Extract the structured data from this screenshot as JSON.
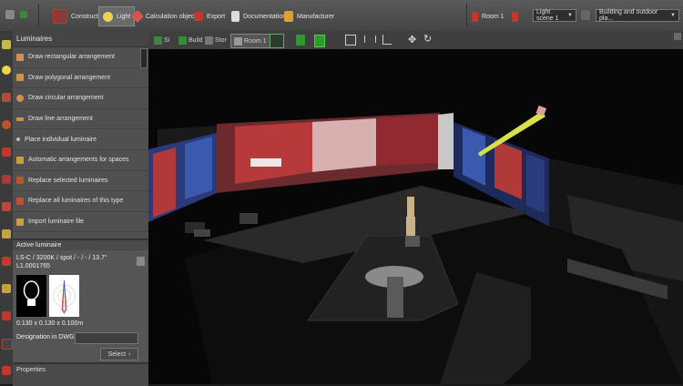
{
  "toolbar": {
    "tabs": [
      {
        "label": "Construction",
        "icon": "construction-icon",
        "color": "#c0392b"
      },
      {
        "label": "Light",
        "icon": "light-bulb-icon",
        "color": "#e8d44d"
      },
      {
        "label": "Calculation objects",
        "icon": "calculation-objects-icon",
        "color": "#d9534f"
      },
      {
        "label": "Export",
        "icon": "export-icon",
        "color": "#c0392b"
      },
      {
        "label": "Documentation",
        "icon": "documentation-icon",
        "color": "#dddddd"
      },
      {
        "label": "Manufacturer",
        "icon": "manufacturer-icon",
        "color": "#e0a030"
      }
    ],
    "room": "Room 1",
    "light_scene": "Light scene 1",
    "view_mode": "Building and outdoor pla..."
  },
  "panel": {
    "title": "Luminaires",
    "items": [
      {
        "label": "Draw rectangular arrangement",
        "icon": "rectangular-arrangement-icon"
      },
      {
        "label": "Draw polygonal arrangement",
        "icon": "polygonal-arrangement-icon"
      },
      {
        "label": "Draw circular arrangement",
        "icon": "circular-arrangement-icon"
      },
      {
        "label": "Draw line arrangement",
        "icon": "line-arrangement-icon"
      },
      {
        "label": "Place individual luminaire",
        "icon": "individual-luminaire-icon"
      },
      {
        "label": "Automatic arrangements for spaces",
        "icon": "automatic-arrangement-icon"
      },
      {
        "label": "Replace selected luminaires",
        "icon": "replace-selected-icon"
      },
      {
        "label": "Replace all luminaires of this type",
        "icon": "replace-all-icon"
      },
      {
        "label": "Import luminaire file",
        "icon": "import-file-icon"
      }
    ]
  },
  "active_luminaire": {
    "title": "Active luminaire",
    "name": "LS-C / 3200K / spot / - / - / 13.7°",
    "code": "L1.0001765",
    "dimensions": "0.130 x 0.130 x 0.100m",
    "designation_label": "Designation in DWG plan",
    "designation_value": "",
    "select_label": "Select"
  },
  "properties": {
    "title": "Properties"
  },
  "viewbar": {
    "items": [
      {
        "label": "Si",
        "icon": "site-icon"
      },
      {
        "label": "Build",
        "icon": "building-icon"
      },
      {
        "label": "Stor",
        "icon": "storey-icon"
      },
      {
        "label": "Room 1",
        "icon": "room-icon"
      }
    ]
  }
}
